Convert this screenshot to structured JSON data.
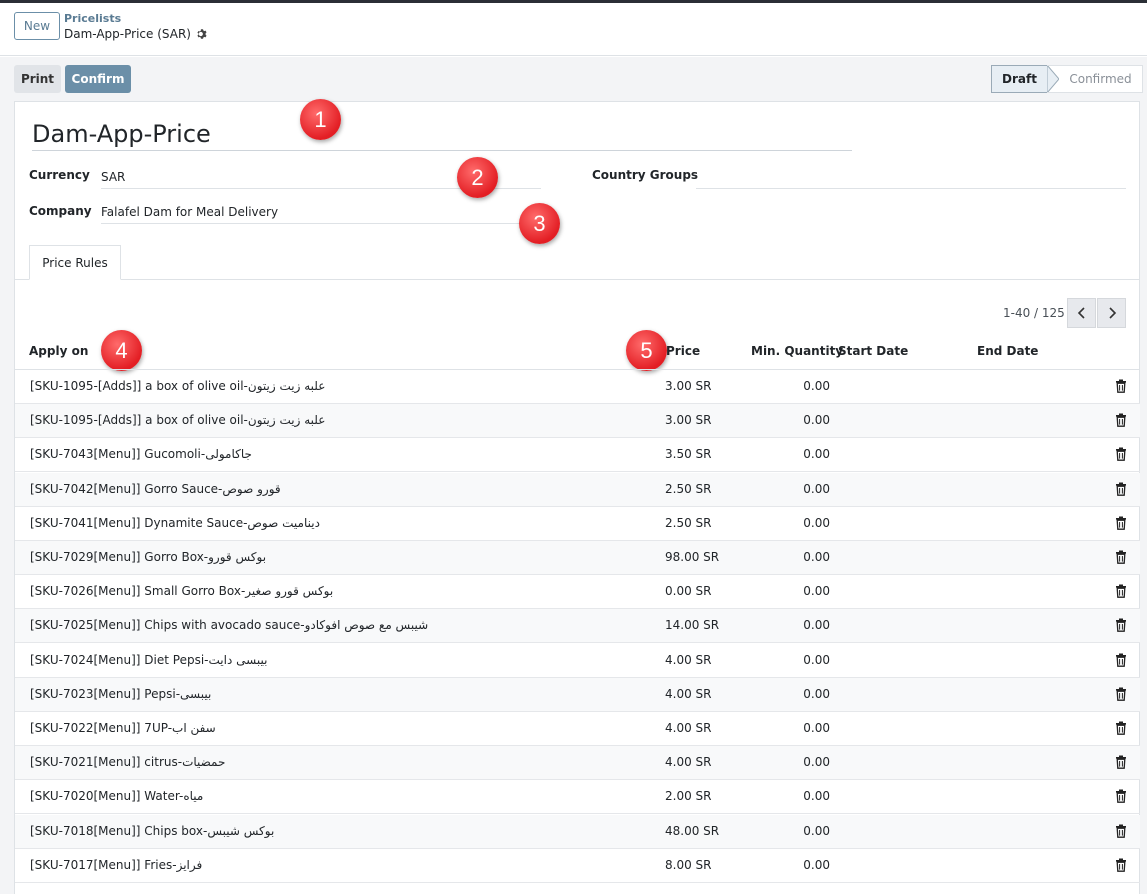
{
  "breadcrumb": {
    "new_label": "New",
    "parent": "Pricelists",
    "current": "Dam-App-Price (SAR)"
  },
  "toolbar": {
    "print_label": "Print",
    "confirm_label": "Confirm"
  },
  "status": {
    "steps": [
      "Draft",
      "Confirmed"
    ],
    "active": "Draft"
  },
  "form": {
    "name": "Dam-App-Price",
    "currency_label": "Currency",
    "currency_value": "SAR",
    "company_label": "Company",
    "company_value": "Falafel Dam for Meal Delivery",
    "country_groups_label": "Country Groups",
    "country_groups_value": ""
  },
  "annotations": [
    "1",
    "2",
    "3",
    "4",
    "5"
  ],
  "tabs": [
    "Price Rules"
  ],
  "pager": {
    "text": "1-40 / 125"
  },
  "table": {
    "columns": [
      "Apply on",
      "Price",
      "Min. Quantity",
      "Start Date",
      "End Date"
    ],
    "rows": [
      {
        "apply_on": "[SKU-1095-[Adds]] a box of olive oil-علبه زيت زيتون",
        "price": "3.00 SR",
        "min_qty": "0.00"
      },
      {
        "apply_on": "[SKU-1095-[Adds]] a box of olive oil-علبه زيت زيتون",
        "price": "3.00 SR",
        "min_qty": "0.00"
      },
      {
        "apply_on": "[SKU-7043[Menu]] Gucomoli-جاكامولى",
        "price": "3.50 SR",
        "min_qty": "0.00"
      },
      {
        "apply_on": "[SKU-7042[Menu]] Gorro Sauce-قورو صوص",
        "price": "2.50 SR",
        "min_qty": "0.00"
      },
      {
        "apply_on": "[SKU-7041[Menu]] Dynamite Sauce-ديناميت صوص",
        "price": "2.50 SR",
        "min_qty": "0.00"
      },
      {
        "apply_on": "[SKU-7029[Menu]] Gorro Box-بوكس قورو",
        "price": "98.00 SR",
        "min_qty": "0.00"
      },
      {
        "apply_on": "[SKU-7026[Menu]] Small Gorro Box-بوكس قورو صغير",
        "price": "0.00 SR",
        "min_qty": "0.00"
      },
      {
        "apply_on": "[SKU-7025[Menu]] Chips with avocado sauce-شيبس مع صوص افوكادو",
        "price": "14.00 SR",
        "min_qty": "0.00"
      },
      {
        "apply_on": "[SKU-7024[Menu]] Diet Pepsi-بيبسى دايت",
        "price": "4.00 SR",
        "min_qty": "0.00"
      },
      {
        "apply_on": "[SKU-7023[Menu]] Pepsi-بيبسى",
        "price": "4.00 SR",
        "min_qty": "0.00"
      },
      {
        "apply_on": "[SKU-7022[Menu]] 7UP-سفن اب",
        "price": "4.00 SR",
        "min_qty": "0.00"
      },
      {
        "apply_on": "[SKU-7021[Menu]] citrus-حمضيات",
        "price": "4.00 SR",
        "min_qty": "0.00"
      },
      {
        "apply_on": "[SKU-7020[Menu]] Water-مياه",
        "price": "2.00 SR",
        "min_qty": "0.00"
      },
      {
        "apply_on": "[SKU-7018[Menu]] Chips box-بوكس شيبس",
        "price": "48.00 SR",
        "min_qty": "0.00"
      },
      {
        "apply_on": "[SKU-7017[Menu]] Fries-فرايز",
        "price": "8.00 SR",
        "min_qty": "0.00"
      }
    ]
  }
}
